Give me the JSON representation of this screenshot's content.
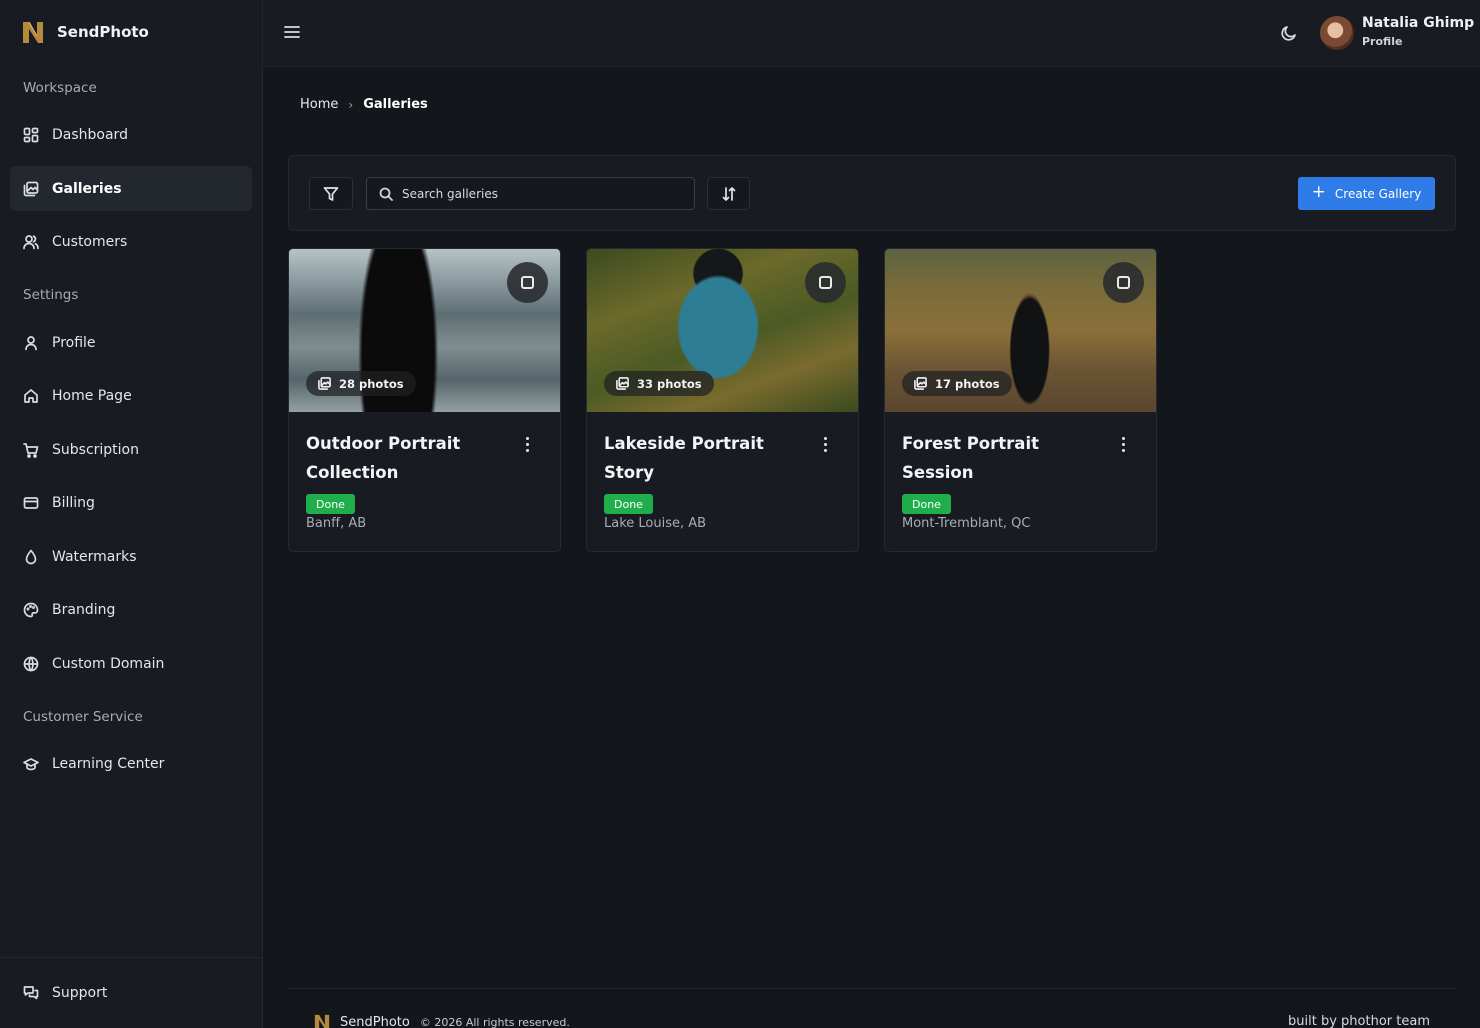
{
  "app": {
    "name": "SendPhoto"
  },
  "sidebar": {
    "sections": [
      {
        "title": "Workspace"
      },
      {
        "title": "Settings"
      },
      {
        "title": "Customer Service"
      }
    ],
    "items": [
      {
        "label": "Dashboard",
        "icon": "dashboard-icon"
      },
      {
        "label": "Galleries",
        "icon": "gallery-icon",
        "active": true
      },
      {
        "label": "Customers",
        "icon": "users-icon"
      },
      {
        "label": "Profile",
        "icon": "user-icon"
      },
      {
        "label": "Home Page",
        "icon": "home-icon"
      },
      {
        "label": "Subscription",
        "icon": "cart-icon"
      },
      {
        "label": "Billing",
        "icon": "credit-card-icon"
      },
      {
        "label": "Watermarks",
        "icon": "droplet-icon"
      },
      {
        "label": "Branding",
        "icon": "palette-icon"
      },
      {
        "label": "Custom Domain",
        "icon": "globe-icon"
      },
      {
        "label": "Learning Center",
        "icon": "graduation-cap-icon"
      }
    ],
    "support": {
      "label": "Support",
      "icon": "chat-icon"
    }
  },
  "header": {
    "user": {
      "name": "Natalia Ghimp",
      "role": "Profile"
    }
  },
  "breadcrumb": {
    "home": "Home",
    "separator": "›",
    "current": "Galleries"
  },
  "toolbar": {
    "search_placeholder": "Search galleries",
    "create_label": "Create Gallery",
    "create_plus": "+"
  },
  "galleries": [
    {
      "title": "Outdoor Portrait Collection",
      "photos": "28 photos",
      "status": "Done",
      "location": "Banff, AB"
    },
    {
      "title": "Lakeside Portrait Story",
      "photos": "33 photos",
      "status": "Done",
      "location": "Lake Louise, AB"
    },
    {
      "title": "Forest Portrait Session",
      "photos": "17 photos",
      "status": "Done",
      "location": "Mont-Tremblant, QC"
    }
  ],
  "footer": {
    "brand": "SendPhoto",
    "copyright": "© 2026 All rights reserved.",
    "credit": "built by phothor team"
  },
  "colors": {
    "accent": "#2f7be8",
    "badge_done": "#1fae4b",
    "background": "#13161b",
    "panel": "#181b21"
  }
}
